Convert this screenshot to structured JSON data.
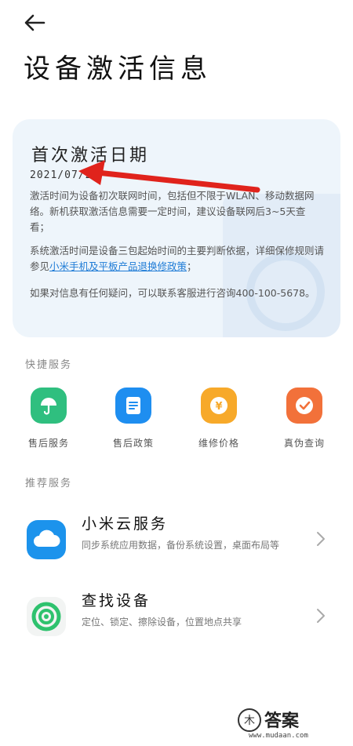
{
  "header": {
    "back_icon": "arrow-left-icon",
    "title": "设备激活信息"
  },
  "activation_card": {
    "heading": "首次激活日期",
    "date": "2021/07/25",
    "paragraph1": "激活时间为设备初次联网时间，包括但不限于WLAN、移动数据网络。新机获取激活信息需要一定时间，建议设备联网后3~5天查看；",
    "paragraph2_prefix": "系统激活时间是设备三包起始时间的主要判断依据，详细保修规则请参见",
    "policy_link": "小米手机及平板产品退换修政策",
    "paragraph2_suffix": "；",
    "paragraph3": "如果对信息有任何疑问，可以联系客服进行咨询400-100-5678。"
  },
  "quick_services": {
    "title": "快捷服务",
    "items": [
      {
        "label": "售后服务",
        "icon": "umbrella-icon",
        "color": "#2fbf7f"
      },
      {
        "label": "售后政策",
        "icon": "document-icon",
        "color": "#1e8ef0"
      },
      {
        "label": "维修价格",
        "icon": "yen-coin-icon",
        "color": "#f7a92a"
      },
      {
        "label": "真伪查询",
        "icon": "check-badge-icon",
        "color": "#f2713a"
      }
    ]
  },
  "recommended": {
    "title": "推荐服务",
    "items": [
      {
        "title": "小米云服务",
        "desc": "同步系统应用数据，备份系统设置，桌面布局等",
        "icon": "cloud-icon",
        "color": "#1c93ec"
      },
      {
        "title": "查找设备",
        "desc": "定位、锁定、擦除设备，位置地点共享",
        "icon": "radar-icon",
        "color": "#2ec26e"
      }
    ]
  },
  "watermark": {
    "name": "答案",
    "url": "www.mudaan.com"
  }
}
